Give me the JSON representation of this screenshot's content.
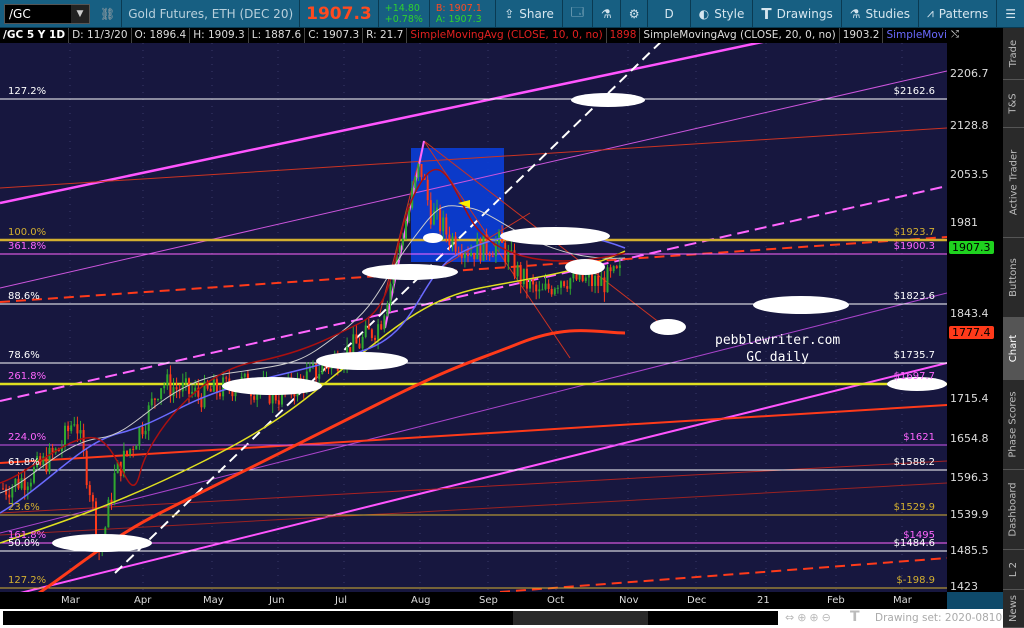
{
  "toolbar": {
    "symbol": "/GC",
    "description": "Gold Futures, ETH (DEC 20)",
    "last": "1907.3",
    "change": "+14.80",
    "change_pct": "+0.78%",
    "bid": "B: 1907.1",
    "ask": "A: 1907.3",
    "share": "Share",
    "period": "D",
    "style": "Style",
    "drawings": "Drawings",
    "studies": "Studies",
    "patterns": "Patterns"
  },
  "header": {
    "title": "/GC 5 Y 1D",
    "date": "D: 11/3/20",
    "open": "O: 1896.4",
    "high": "H: 1909.3",
    "low": "L: 1887.6",
    "close": "C: 1907.3",
    "range": "R: 21.7",
    "sma10": "SimpleMovingAvg (CLOSE, 10, 0, no)",
    "sma10_val": "1898",
    "sma20": "SimpleMovingAvg (CLOSE, 20, 0, no)",
    "sma20_val": "1903.2",
    "sma3": "SimpleMovingAvg ..."
  },
  "price_axis": [
    "2206.7",
    "2128.8",
    "2053.5",
    "1981",
    "1843.4",
    "1715.4",
    "1654.8",
    "1596.3",
    "1539.9",
    "1485.5",
    "1423"
  ],
  "price_markers": {
    "last": "1907.3",
    "sma": "1777.4"
  },
  "fib_left": [
    {
      "label": "127.2%",
      "color": "#ffffff"
    },
    {
      "label": "100.0%",
      "color": "#d4b030"
    },
    {
      "label": "361.8%",
      "color": "#ff66ff"
    },
    {
      "label": "88.6%",
      "color": "#ffffff"
    },
    {
      "label": "78.6%",
      "color": "#ffffff"
    },
    {
      "label": "261.8%",
      "color": "#ff66ff"
    },
    {
      "label": "224.0%",
      "color": "#ff66ff"
    },
    {
      "label": "61.8%",
      "color": "#ffffff"
    },
    {
      "label": "23.6%",
      "color": "#d4b030"
    },
    {
      "label": "161.8%",
      "color": "#ff66ff"
    },
    {
      "label": "50.0%",
      "color": "#ffffff"
    },
    {
      "label": "127.2%",
      "color": "#d4b030"
    }
  ],
  "fib_right": [
    {
      "label": "$2162.6",
      "color": "#ffffff"
    },
    {
      "label": "$1923.7",
      "color": "#d4b030"
    },
    {
      "label": "$1900.3",
      "color": "#ff66ff"
    },
    {
      "label": "$1823.6",
      "color": "#ffffff"
    },
    {
      "label": "$1735.7",
      "color": "#ffffff"
    },
    {
      "label": "$1697.7",
      "color": "#ff66ff"
    },
    {
      "label": "$1621",
      "color": "#ff66ff"
    },
    {
      "label": "$1588.2",
      "color": "#ffffff"
    },
    {
      "label": "$1529.9",
      "color": "#d4b030"
    },
    {
      "label": "$1495",
      "color": "#ff66ff"
    },
    {
      "label": "$1484.6",
      "color": "#ffffff"
    },
    {
      "label": "$-198.9",
      "color": "#d4b030"
    }
  ],
  "annotation": {
    "line1": "pebblewriter.com",
    "line2": "GC daily"
  },
  "dates": [
    "Mar",
    "Apr",
    "May",
    "Jun",
    "Jul",
    "Aug",
    "Sep",
    "Oct",
    "Nov",
    "Dec",
    "21",
    "Feb",
    "Mar"
  ],
  "sidebar": [
    "Trade",
    "T&S",
    "Active Trader",
    "Buttons",
    "Chart",
    "Phase Scores",
    "Dashboard",
    "L 2",
    "News"
  ],
  "drawing_set": "Drawing set: 2020-0810",
  "colors": {
    "bg": "#17173f",
    "up": "#2fa82f",
    "down": "#ff3a1a",
    "last": "#1fd21f"
  }
}
